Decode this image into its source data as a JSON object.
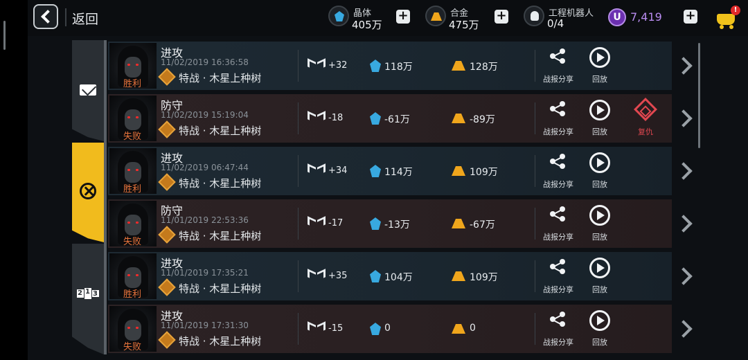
{
  "header": {
    "back_label": "返回",
    "crystal": {
      "name": "晶体",
      "value": "405万"
    },
    "alloy": {
      "name": "合金",
      "value": "475万"
    },
    "robot": {
      "name": "工程机器人",
      "value": "0/4"
    },
    "premium": {
      "symbol": "U",
      "value": "7,419"
    },
    "plus_symbol": "+",
    "cart_badge": "!"
  },
  "tabs": [
    {
      "name": "mail",
      "icon": "envelope-icon",
      "active": false
    },
    {
      "name": "battle",
      "icon": "crossed-swords-icon",
      "active": true
    },
    {
      "name": "ranking",
      "icon": "podium-icon",
      "active": false,
      "digits": [
        "2",
        "1",
        "3"
      ]
    }
  ],
  "labels": {
    "share": "战报分享",
    "replay": "回放",
    "revenge": "复仇"
  },
  "records": [
    {
      "type": "进攻",
      "date": "11/02/2019 16:36:58",
      "result": "胜利",
      "mission": "特战 · 木星上种树",
      "rank_delta": "+32",
      "crystal": "118万",
      "alloy": "128万",
      "revenge": false,
      "outcome": "win"
    },
    {
      "type": "防守",
      "date": "11/02/2019 15:19:04",
      "result": "失败",
      "mission": "特战 · 木星上种树",
      "rank_delta": "-18",
      "crystal": "-61万",
      "alloy": "-89万",
      "revenge": true,
      "outcome": "lose"
    },
    {
      "type": "进攻",
      "date": "11/02/2019 06:47:44",
      "result": "胜利",
      "mission": "特战 · 木星上种树",
      "rank_delta": "+34",
      "crystal": "114万",
      "alloy": "109万",
      "revenge": false,
      "outcome": "win"
    },
    {
      "type": "防守",
      "date": "11/01/2019 22:53:36",
      "result": "失败",
      "mission": "特战 · 木星上种树",
      "rank_delta": "-17",
      "crystal": "-13万",
      "alloy": "-67万",
      "revenge": false,
      "outcome": "lose"
    },
    {
      "type": "进攻",
      "date": "11/01/2019 17:35:21",
      "result": "胜利",
      "mission": "特战 · 木星上种树",
      "rank_delta": "+35",
      "crystal": "104万",
      "alloy": "109万",
      "revenge": false,
      "outcome": "win"
    },
    {
      "type": "进攻",
      "date": "11/01/2019 17:31:30",
      "result": "失败",
      "mission": "特战 · 木星上种树",
      "rank_delta": "-15",
      "crystal": "0",
      "alloy": "0",
      "revenge": false,
      "outcome": "lose"
    }
  ],
  "colors": {
    "accent": "#f1bb1d",
    "win_result": "#e8743c",
    "revenge": "#e24750",
    "crystal": "#38a9e0",
    "alloy": "#f0a61c",
    "premium": "#b98cf0"
  }
}
